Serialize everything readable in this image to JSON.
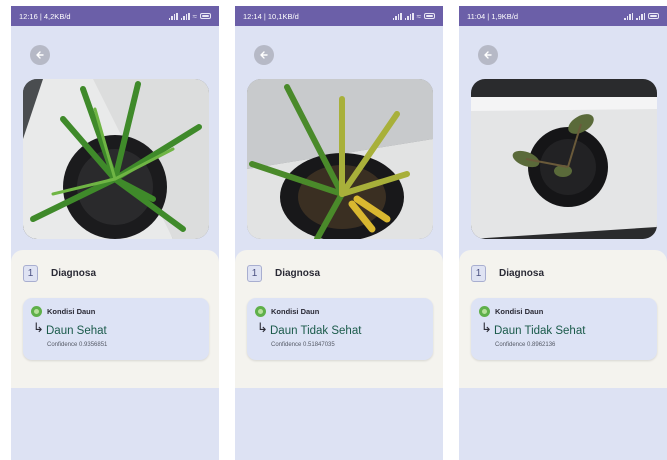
{
  "colors": {
    "status_bar": "#6b5fa8",
    "screen_bg": "#dde2f3",
    "result_text": "#1a5a4a"
  },
  "panels": [
    {
      "status_time": "12:16 | 4,2KB/d",
      "section_number": "1",
      "section_title": "Diagnosa",
      "card_label": "Kondisi Daun",
      "result": "Daun Sehat",
      "confidence": "Confidence 0.9356851"
    },
    {
      "status_time": "12:14 | 10,1KB/d",
      "section_number": "1",
      "section_title": "Diagnosa",
      "card_label": "Kondisi Daun",
      "result": "Daun Tidak Sehat",
      "confidence": "Confidence 0.51847035"
    },
    {
      "status_time": "11:04 | 1,9KB/d",
      "section_number": "1",
      "section_title": "Diagnosa",
      "card_label": "Kondisi Daun",
      "result": "Daun Tidak Sehat",
      "confidence": "Confidence 0.8962136"
    }
  ]
}
